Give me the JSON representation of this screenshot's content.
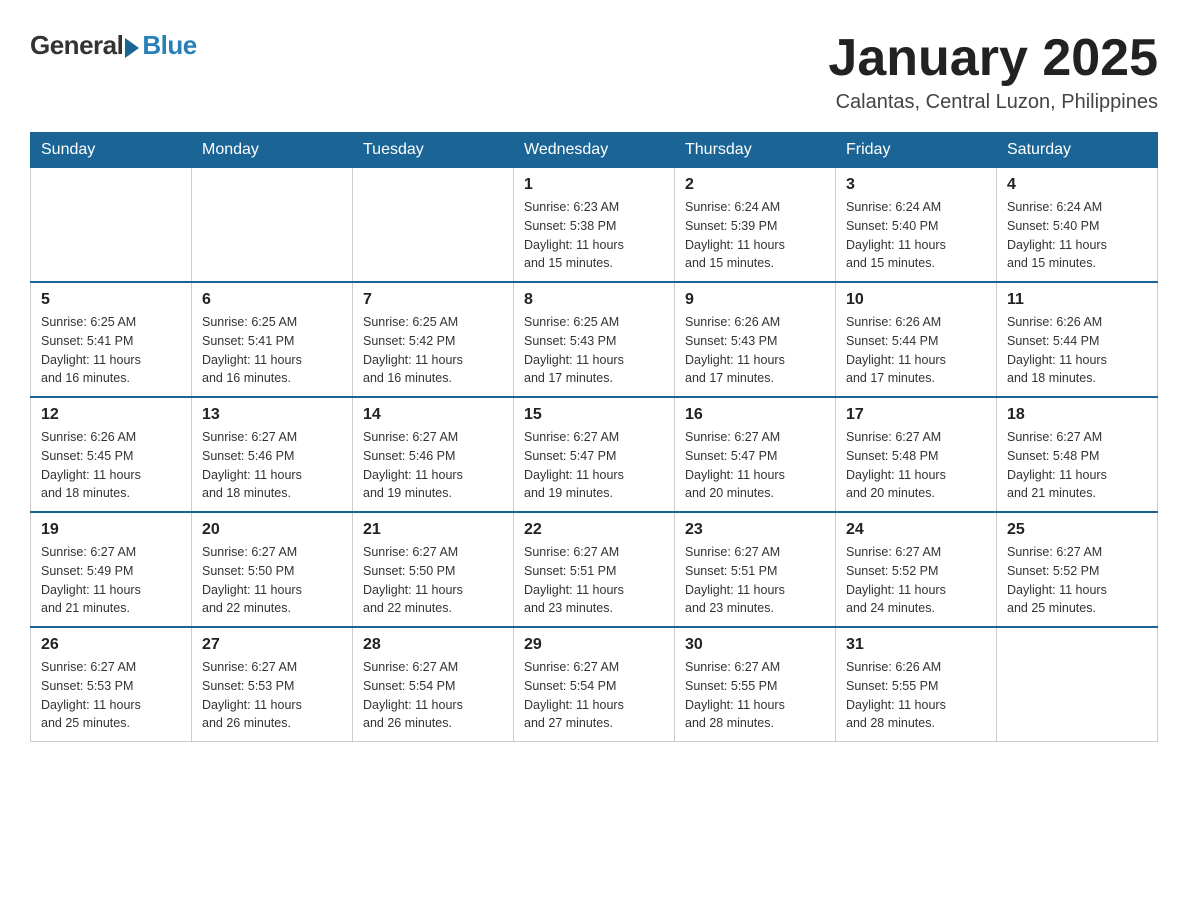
{
  "header": {
    "logo_general": "General",
    "logo_blue": "Blue",
    "month_title": "January 2025",
    "location": "Calantas, Central Luzon, Philippines"
  },
  "weekdays": [
    "Sunday",
    "Monday",
    "Tuesday",
    "Wednesday",
    "Thursday",
    "Friday",
    "Saturday"
  ],
  "weeks": [
    [
      {
        "day": "",
        "info": ""
      },
      {
        "day": "",
        "info": ""
      },
      {
        "day": "",
        "info": ""
      },
      {
        "day": "1",
        "info": "Sunrise: 6:23 AM\nSunset: 5:38 PM\nDaylight: 11 hours\nand 15 minutes."
      },
      {
        "day": "2",
        "info": "Sunrise: 6:24 AM\nSunset: 5:39 PM\nDaylight: 11 hours\nand 15 minutes."
      },
      {
        "day": "3",
        "info": "Sunrise: 6:24 AM\nSunset: 5:40 PM\nDaylight: 11 hours\nand 15 minutes."
      },
      {
        "day": "4",
        "info": "Sunrise: 6:24 AM\nSunset: 5:40 PM\nDaylight: 11 hours\nand 15 minutes."
      }
    ],
    [
      {
        "day": "5",
        "info": "Sunrise: 6:25 AM\nSunset: 5:41 PM\nDaylight: 11 hours\nand 16 minutes."
      },
      {
        "day": "6",
        "info": "Sunrise: 6:25 AM\nSunset: 5:41 PM\nDaylight: 11 hours\nand 16 minutes."
      },
      {
        "day": "7",
        "info": "Sunrise: 6:25 AM\nSunset: 5:42 PM\nDaylight: 11 hours\nand 16 minutes."
      },
      {
        "day": "8",
        "info": "Sunrise: 6:25 AM\nSunset: 5:43 PM\nDaylight: 11 hours\nand 17 minutes."
      },
      {
        "day": "9",
        "info": "Sunrise: 6:26 AM\nSunset: 5:43 PM\nDaylight: 11 hours\nand 17 minutes."
      },
      {
        "day": "10",
        "info": "Sunrise: 6:26 AM\nSunset: 5:44 PM\nDaylight: 11 hours\nand 17 minutes."
      },
      {
        "day": "11",
        "info": "Sunrise: 6:26 AM\nSunset: 5:44 PM\nDaylight: 11 hours\nand 18 minutes."
      }
    ],
    [
      {
        "day": "12",
        "info": "Sunrise: 6:26 AM\nSunset: 5:45 PM\nDaylight: 11 hours\nand 18 minutes."
      },
      {
        "day": "13",
        "info": "Sunrise: 6:27 AM\nSunset: 5:46 PM\nDaylight: 11 hours\nand 18 minutes."
      },
      {
        "day": "14",
        "info": "Sunrise: 6:27 AM\nSunset: 5:46 PM\nDaylight: 11 hours\nand 19 minutes."
      },
      {
        "day": "15",
        "info": "Sunrise: 6:27 AM\nSunset: 5:47 PM\nDaylight: 11 hours\nand 19 minutes."
      },
      {
        "day": "16",
        "info": "Sunrise: 6:27 AM\nSunset: 5:47 PM\nDaylight: 11 hours\nand 20 minutes."
      },
      {
        "day": "17",
        "info": "Sunrise: 6:27 AM\nSunset: 5:48 PM\nDaylight: 11 hours\nand 20 minutes."
      },
      {
        "day": "18",
        "info": "Sunrise: 6:27 AM\nSunset: 5:48 PM\nDaylight: 11 hours\nand 21 minutes."
      }
    ],
    [
      {
        "day": "19",
        "info": "Sunrise: 6:27 AM\nSunset: 5:49 PM\nDaylight: 11 hours\nand 21 minutes."
      },
      {
        "day": "20",
        "info": "Sunrise: 6:27 AM\nSunset: 5:50 PM\nDaylight: 11 hours\nand 22 minutes."
      },
      {
        "day": "21",
        "info": "Sunrise: 6:27 AM\nSunset: 5:50 PM\nDaylight: 11 hours\nand 22 minutes."
      },
      {
        "day": "22",
        "info": "Sunrise: 6:27 AM\nSunset: 5:51 PM\nDaylight: 11 hours\nand 23 minutes."
      },
      {
        "day": "23",
        "info": "Sunrise: 6:27 AM\nSunset: 5:51 PM\nDaylight: 11 hours\nand 23 minutes."
      },
      {
        "day": "24",
        "info": "Sunrise: 6:27 AM\nSunset: 5:52 PM\nDaylight: 11 hours\nand 24 minutes."
      },
      {
        "day": "25",
        "info": "Sunrise: 6:27 AM\nSunset: 5:52 PM\nDaylight: 11 hours\nand 25 minutes."
      }
    ],
    [
      {
        "day": "26",
        "info": "Sunrise: 6:27 AM\nSunset: 5:53 PM\nDaylight: 11 hours\nand 25 minutes."
      },
      {
        "day": "27",
        "info": "Sunrise: 6:27 AM\nSunset: 5:53 PM\nDaylight: 11 hours\nand 26 minutes."
      },
      {
        "day": "28",
        "info": "Sunrise: 6:27 AM\nSunset: 5:54 PM\nDaylight: 11 hours\nand 26 minutes."
      },
      {
        "day": "29",
        "info": "Sunrise: 6:27 AM\nSunset: 5:54 PM\nDaylight: 11 hours\nand 27 minutes."
      },
      {
        "day": "30",
        "info": "Sunrise: 6:27 AM\nSunset: 5:55 PM\nDaylight: 11 hours\nand 28 minutes."
      },
      {
        "day": "31",
        "info": "Sunrise: 6:26 AM\nSunset: 5:55 PM\nDaylight: 11 hours\nand 28 minutes."
      },
      {
        "day": "",
        "info": ""
      }
    ]
  ]
}
